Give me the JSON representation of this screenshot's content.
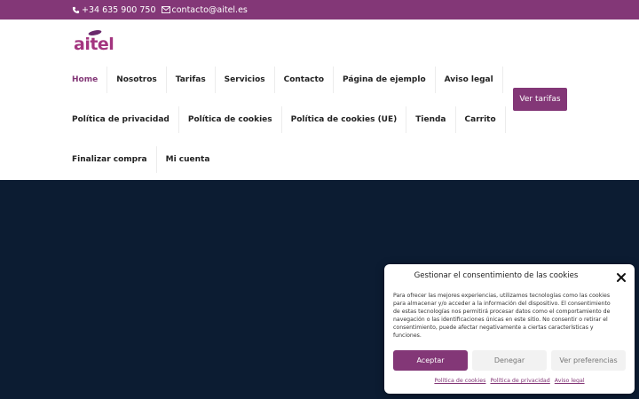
{
  "topbar": {
    "phone": "+34 635 900 750",
    "email": "contacto@aitel.es",
    "phone_icon": "phone-icon",
    "email_icon": "envelope-icon"
  },
  "logo": {
    "text": "aitel"
  },
  "nav": {
    "row1": [
      "Home",
      "Nosotros",
      "Tarifas",
      "Servicios",
      "Contacto",
      "Página de ejemplo",
      "Aviso legal"
    ],
    "row2": [
      "Política de privacidad",
      "Política de cookies",
      "Política de cookies (UE)",
      "Tienda",
      "Carrito"
    ],
    "row3": [
      "Finalizar compra",
      "Mi cuenta"
    ]
  },
  "cta": {
    "label": "Ver tarifas"
  },
  "consent": {
    "title": "Gestionar el consentimiento de las cookies",
    "body": "Para ofrecer las mejores experiencias, utilizamos tecnologías como las cookies para almacenar y/o acceder a la información del dispositivo. El consentimiento de estas tecnologías nos permitirá procesar datos como el comportamiento de navegación o las identificaciones únicas en este sitio. No consentir o retirar el consentimiento, puede afectar negativamente a ciertas características y funciones.",
    "accept": "Aceptar",
    "deny": "Denegar",
    "prefs": "Ver preferencias",
    "links": [
      "Política de cookies",
      "Política de privacidad",
      "Aviso legal"
    ]
  },
  "colors": {
    "brand": "#833777",
    "hero_bg": "#0c1c32"
  }
}
